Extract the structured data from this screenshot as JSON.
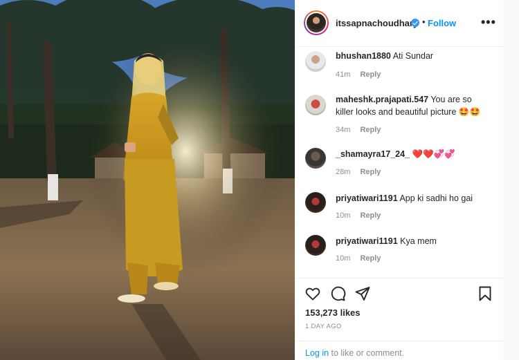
{
  "post": {
    "username": "itssapnachoudhary",
    "separator": "•",
    "follow_label": "Follow",
    "more_label": "•••"
  },
  "comments": [
    {
      "user": "bhushan1880",
      "text": "Ati Sundar",
      "time": "41m",
      "reply": "Reply"
    },
    {
      "user": "maheshk.prajapati.547",
      "text": "You are so killer looks and beautiful picture 🤩🤩",
      "time": "34m",
      "reply": "Reply"
    },
    {
      "user": "_shamayra17_24_",
      "text": "❤️❤️💞💞",
      "time": "28m",
      "reply": "Reply"
    },
    {
      "user": "priyatiwari1191",
      "text": "App ki sadhi ho gai",
      "time": "10m",
      "reply": "Reply"
    },
    {
      "user": "priyatiwari1191",
      "text": "Kya mem",
      "time": "10m",
      "reply": "Reply"
    }
  ],
  "engagement": {
    "likes": "153,273 likes",
    "posted": "1 DAY AGO"
  },
  "login": {
    "link": "Log in",
    "rest": " to like or comment."
  },
  "colors": {
    "accent": "#0095f6",
    "verified": "#3897f0",
    "muted": "#8e8e8e",
    "text": "#262626"
  },
  "icons": [
    "heart-icon",
    "comment-icon",
    "share-icon",
    "bookmark-icon",
    "verified-badge-icon"
  ]
}
